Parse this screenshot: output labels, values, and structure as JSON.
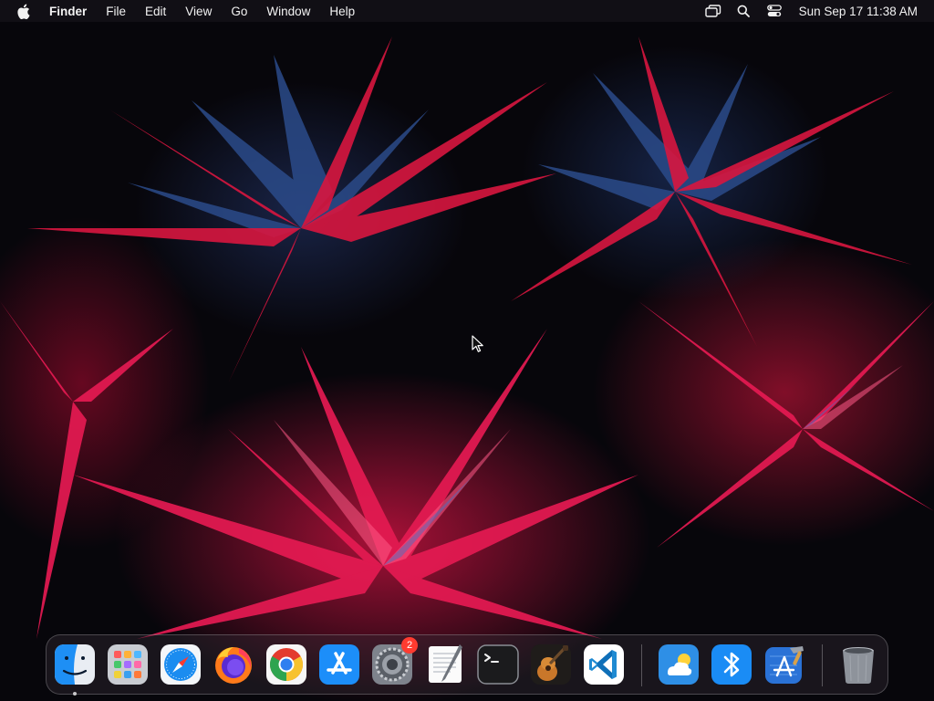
{
  "menubar": {
    "app_name": "Finder",
    "menus": [
      "File",
      "Edit",
      "View",
      "Go",
      "Window",
      "Help"
    ],
    "status_icons": [
      "screen-mirroring-icon",
      "spotlight-search-icon",
      "control-center-icon"
    ],
    "clock": "Sun Sep 17  11:38 AM"
  },
  "dock": {
    "apps": [
      {
        "name": "Finder",
        "icon": "finder-icon",
        "running": true
      },
      {
        "name": "Launchpad",
        "icon": "launchpad-icon"
      },
      {
        "name": "Safari",
        "icon": "safari-icon"
      },
      {
        "name": "Firefox",
        "icon": "firefox-icon"
      },
      {
        "name": "Google Chrome",
        "icon": "chrome-icon"
      },
      {
        "name": "App Store",
        "icon": "app-store-icon"
      },
      {
        "name": "System Settings",
        "icon": "system-settings-icon",
        "badge": "2"
      },
      {
        "name": "TextEdit",
        "icon": "textedit-icon"
      },
      {
        "name": "Terminal",
        "icon": "terminal-icon"
      },
      {
        "name": "GarageBand",
        "icon": "garageband-icon"
      },
      {
        "name": "Visual Studio Code",
        "icon": "vscode-icon"
      }
    ],
    "utilities": [
      {
        "name": "Weather",
        "icon": "weather-icon"
      },
      {
        "name": "Bluetooth File Exchange",
        "icon": "bluetooth-icon"
      },
      {
        "name": "Xcode",
        "icon": "xcode-icon"
      }
    ],
    "trash": {
      "name": "Trash",
      "icon": "trash-icon"
    }
  },
  "colors": {
    "wallpaper_red": "#e0184a",
    "wallpaper_blue": "#2c4d8c",
    "menubar_bg": "#141218"
  }
}
